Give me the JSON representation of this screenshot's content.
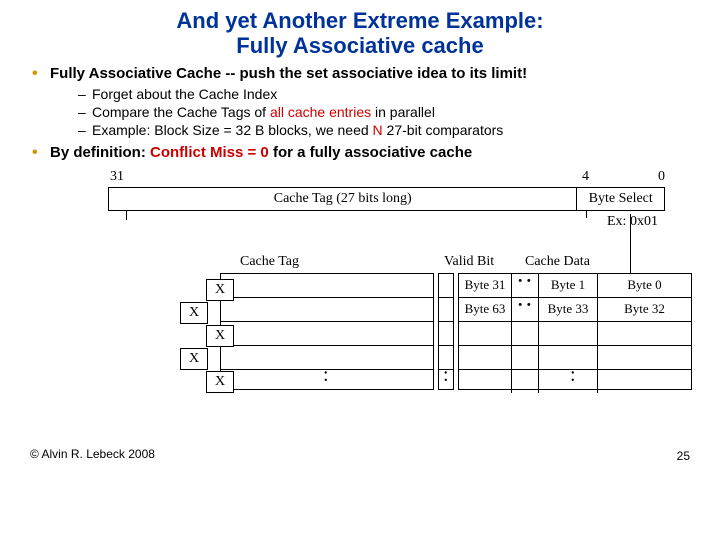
{
  "title_line1": "And yet Another Extreme Example:",
  "title_line2": "Fully Associative cache",
  "b1_a": "Fully Associative Cache",
  "b1_b": " -- push the set associative idea to its limit!",
  "b1s1": "Forget about the Cache Index",
  "b1s2a": "Compare the Cache Tags of ",
  "b1s2b": " all cache entries",
  "b1s2c": " in parallel",
  "b1s3a": "Example: Block Size = 32 B blocks, we need ",
  "b1s3b": "N",
  "b1s3c": " 27-bit comparators",
  "b2a": "By definition: ",
  "b2b": "Conflict Miss = 0 ",
  "b2c": " for a fully associative cache",
  "addr": {
    "bit31": "31",
    "bit4": "4",
    "bit0": "0",
    "tag": "Cache Tag (27 bits long)",
    "bsel": "Byte Select",
    "ex": "Ex: 0x01"
  },
  "labels": {
    "ctag": "Cache Tag",
    "vbit": "Valid Bit",
    "cdata": "Cache Data"
  },
  "data": {
    "r0": {
      "c1": "Byte 31",
      "c3": "Byte 1",
      "c4": "Byte 0"
    },
    "r1": {
      "c1": "Byte 63",
      "c3": "Byte 33",
      "c4": "Byte 32"
    }
  },
  "cmp": "X",
  "colon": ":",
  "copyright": "© Alvin R. Lebeck 2008",
  "page": "25"
}
